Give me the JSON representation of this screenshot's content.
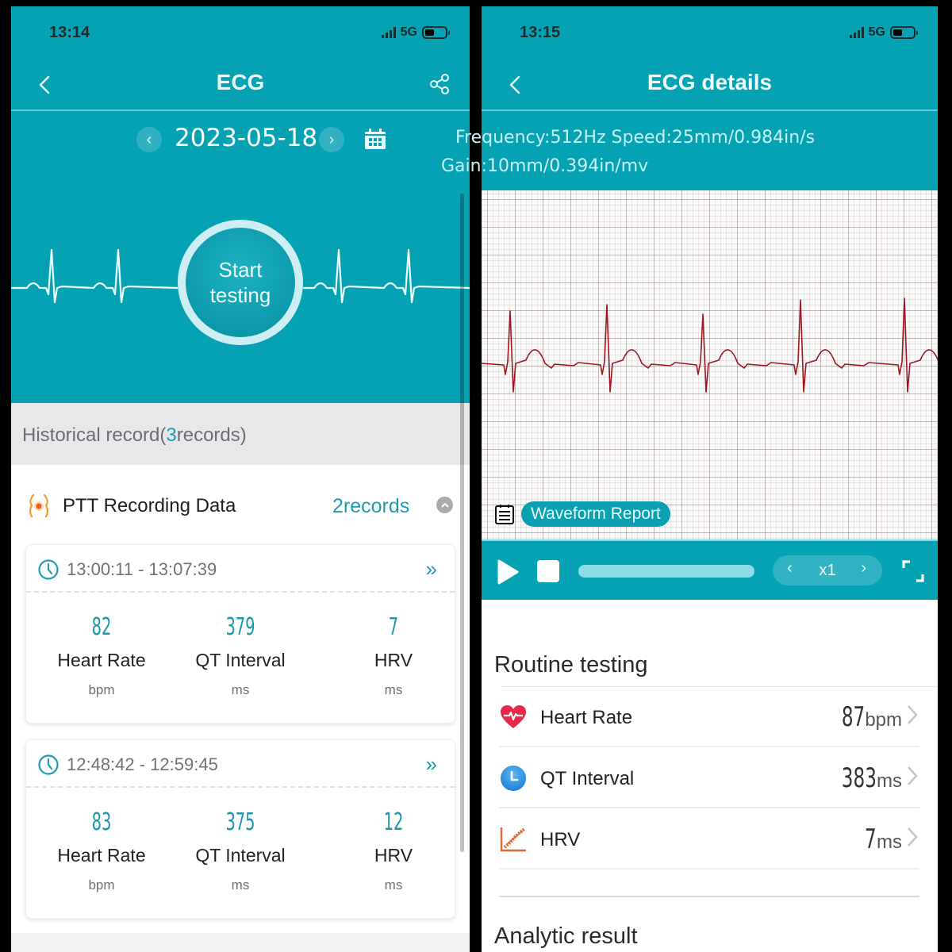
{
  "left_screen": {
    "status_bar": {
      "time": "13:14",
      "network": "5G"
    },
    "nav": {
      "title": "ECG",
      "back_icon": "chevron-left-icon",
      "share_icon": "share-icon"
    },
    "date_picker": {
      "date": "2023-05-18",
      "prev_icon": "chevron-left-icon",
      "next_icon": "chevron-right-icon",
      "calendar_icon": "calendar-icon"
    },
    "start_button": {
      "line1": "Start",
      "line2": "testing"
    },
    "history": {
      "prefix": "Historical record(",
      "count": "3",
      "suffix": "records)"
    },
    "ptt_section": {
      "title": "PTT Recording Data",
      "count_label": "2records",
      "icon": "body-pulse-icon",
      "records": [
        {
          "time_range": "13:00:11 - 13:07:39",
          "metrics": [
            {
              "value": "82",
              "label": "Heart Rate",
              "unit": "bpm"
            },
            {
              "value": "379",
              "label": "QT Interval",
              "unit": "ms"
            },
            {
              "value": "7",
              "label": "HRV",
              "unit": "ms"
            }
          ]
        },
        {
          "time_range": "12:48:42 - 12:59:45",
          "metrics": [
            {
              "value": "83",
              "label": "Heart Rate",
              "unit": "bpm"
            },
            {
              "value": "375",
              "label": "QT Interval",
              "unit": "ms"
            },
            {
              "value": "12",
              "label": "HRV",
              "unit": "ms"
            }
          ]
        }
      ]
    }
  },
  "right_screen": {
    "status_bar": {
      "time": "13:15",
      "network": "5G"
    },
    "nav": {
      "title": "ECG details"
    },
    "spec": {
      "line1": "Frequency:512Hz Speed:25mm/0.984in/s",
      "line2": "Gain:10mm/0.394in/mv"
    },
    "waveform_report_label": "Waveform Report",
    "player": {
      "speed": "x1",
      "progress": 1.0
    },
    "routine": {
      "title": "Routine testing",
      "rows": [
        {
          "label": "Heart Rate",
          "value": "87",
          "unit": "bpm",
          "icon": "heart-icon"
        },
        {
          "label": "QT Interval",
          "value": "383",
          "unit": "ms",
          "icon": "clock-icon"
        },
        {
          "label": "HRV",
          "value": "7",
          "unit": "ms",
          "icon": "hrv-chart-icon"
        }
      ]
    },
    "analytic_title": "Analytic result"
  },
  "colors": {
    "teal": "#05a2b3",
    "accent_value": "#1b97ac",
    "ecg_trace": "#a0151f",
    "heart_red": "#e8294a",
    "hrv_orange": "#e2662d",
    "clock_blue": "#2f8fe0"
  }
}
